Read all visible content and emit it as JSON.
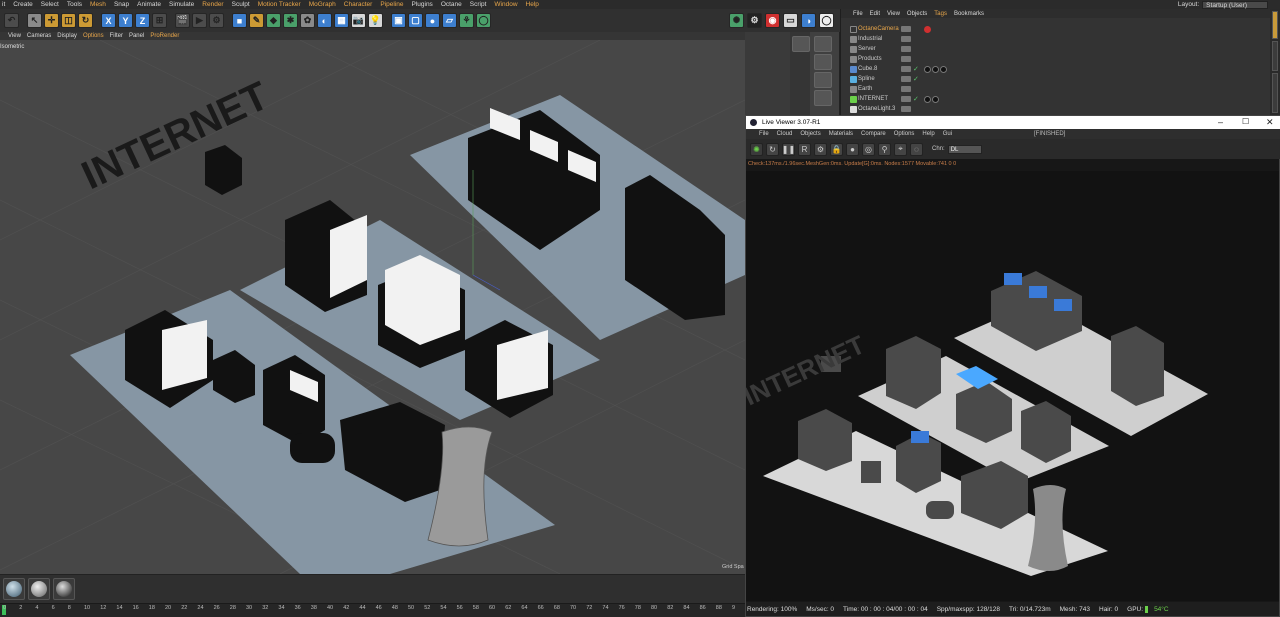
{
  "menubar": {
    "items": [
      "it",
      "Create",
      "Select",
      "Tools",
      "Mesh",
      "Snap",
      "Animate",
      "Simulate",
      "Render",
      "Sculpt",
      "Motion Tracker",
      "MoGraph",
      "Character",
      "Pipeline",
      "Plugins",
      "Octane",
      "Script",
      "Window",
      "Help"
    ],
    "layout_label": "Layout:",
    "layout_value": "Startup (User)"
  },
  "viewport": {
    "menu": [
      "View",
      "Cameras",
      "Display",
      "Options",
      "Filter",
      "Panel",
      "ProRender"
    ],
    "projection_label": "Isometric",
    "grid_label": "Grid Spa",
    "scene_text": "INTERNET"
  },
  "timeline": {
    "frames": [
      "0",
      "2",
      "4",
      "6",
      "8",
      "10",
      "12",
      "14",
      "16",
      "18",
      "20",
      "22",
      "24",
      "26",
      "28",
      "30",
      "32",
      "34",
      "36",
      "38",
      "40",
      "42",
      "44",
      "46",
      "48",
      "50",
      "52",
      "54",
      "56",
      "58",
      "60",
      "62",
      "64",
      "66",
      "68",
      "70",
      "72",
      "74",
      "76",
      "78",
      "80",
      "82",
      "84",
      "86",
      "88",
      "9"
    ]
  },
  "object_manager": {
    "menu": [
      "File",
      "Edit",
      "View",
      "Objects",
      "Tags",
      "Bookmarks"
    ],
    "objects": [
      {
        "name": "OctaneCamera",
        "highlight": true
      },
      {
        "name": "Industrial",
        "highlight": false
      },
      {
        "name": "Server",
        "highlight": false
      },
      {
        "name": "Products",
        "highlight": false
      },
      {
        "name": "Cube.8",
        "highlight": false
      },
      {
        "name": "Spline",
        "highlight": false
      },
      {
        "name": "Earth",
        "highlight": false
      },
      {
        "name": "INTERNET",
        "highlight": false
      },
      {
        "name": "OctaneLight.3",
        "highlight": false
      }
    ]
  },
  "live_viewer": {
    "title": "Live Viewer 3.07-R1",
    "menu": [
      "File",
      "Cloud",
      "Objects",
      "Materials",
      "Compare",
      "Options",
      "Help",
      "Gui"
    ],
    "status_state": "[FINISHED]",
    "channel_label": "Chn:",
    "channel_value": "DL",
    "stats_line": "Check:137ms./1.96sec.MeshGen:0ms. Update[G]:0ms. Nodes:1577 Movable:741 0 0",
    "scene_text": "INTERNET",
    "status": {
      "rendering": "Rendering: 100%",
      "ms_sec": "Ms/sec: 0",
      "time": "Time: 00 : 00 : 04/00 : 00 : 04",
      "spp": "Spp/maxspp: 128/128",
      "tri": "Tri: 0/14.723m",
      "mesh": "Mesh: 743",
      "hair": "Hair: 0",
      "gpu": "GPU:",
      "temp": "54°C"
    }
  },
  "colors": {
    "accent": "#e8a64a",
    "selected_blue": "#3d7fcf",
    "gpu_green": "#6bd04a",
    "stats_orange": "#c77d4a"
  }
}
